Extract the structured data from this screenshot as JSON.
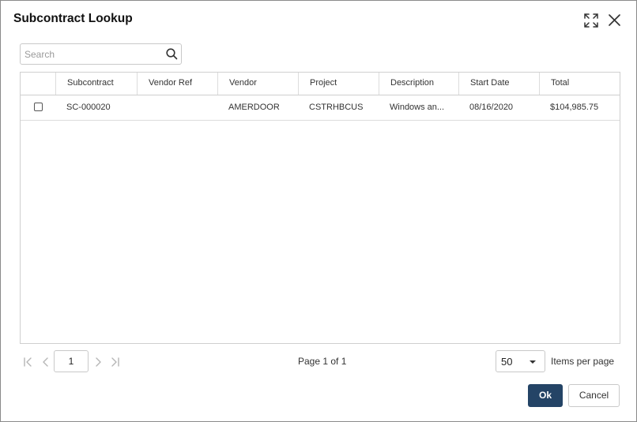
{
  "dialog": {
    "title": "Subcontract Lookup"
  },
  "search": {
    "placeholder": "Search",
    "value": ""
  },
  "icons": {
    "expand": "expand-icon",
    "close": "close-icon",
    "search": "search-icon",
    "first_page": "first-page-icon",
    "prev_page": "prev-page-icon",
    "next_page": "next-page-icon",
    "last_page": "last-page-icon",
    "dropdown": "chevron-down-icon"
  },
  "grid": {
    "columns": [
      "Subcontract",
      "Vendor Ref",
      "Vendor",
      "Project",
      "Description",
      "Start Date",
      "Total"
    ],
    "rows": [
      {
        "checked": false,
        "subcontract": "SC-000020",
        "vendor_ref": "",
        "vendor": "AMERDOOR",
        "project": "CSTRHBCUS",
        "description": "Windows an...",
        "start_date": "08/16/2020",
        "total": "$104,985.75"
      }
    ]
  },
  "pager": {
    "current_page": "1",
    "page_info": "Page 1 of 1",
    "per_page_value": "50",
    "per_page_label": "Items per page"
  },
  "footer": {
    "ok_label": "Ok",
    "cancel_label": "Cancel"
  },
  "colors": {
    "primary": "#244466",
    "border": "#c9c9c9",
    "icon_disabled": "#b5b5b5"
  }
}
